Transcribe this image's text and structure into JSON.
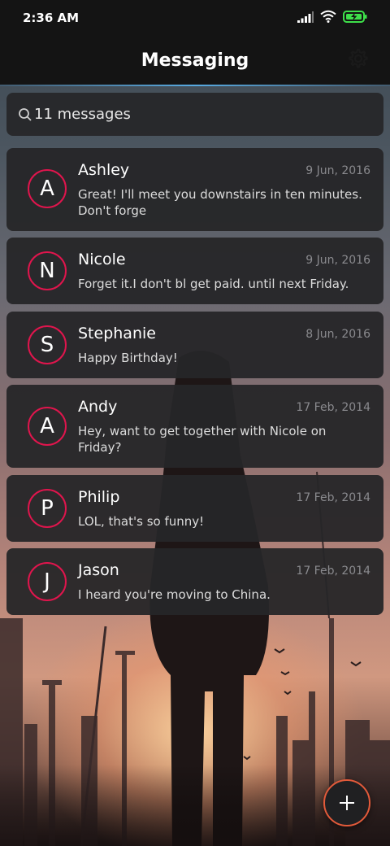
{
  "status_bar": {
    "time": "2:36 AM",
    "icons": [
      "signal-icon",
      "wifi-icon",
      "battery-charging-icon"
    ],
    "battery_color": "#3ee04a"
  },
  "app_bar": {
    "title": "Messaging",
    "settings_icon": "gear-icon"
  },
  "search": {
    "placeholder": "11 messages",
    "icon": "search-icon"
  },
  "accent_color": "#e0154d",
  "conversations": [
    {
      "initial": "A",
      "name": "Ashley",
      "date": "9 Jun, 2016",
      "snippet": "Great! I'll meet you downstairs in ten minutes. Don't forge"
    },
    {
      "initial": "N",
      "name": "Nicole",
      "date": "9 Jun, 2016",
      "snippet": "Forget it.I don't bl get paid. until next Friday."
    },
    {
      "initial": "S",
      "name": "Stephanie",
      "date": "8 Jun, 2016",
      "snippet": "Happy Birthday!"
    },
    {
      "initial": "A",
      "name": "Andy",
      "date": "17 Feb, 2014",
      "snippet": "Hey, want to get together with Nicole on Friday?"
    },
    {
      "initial": "P",
      "name": "Philip",
      "date": "17 Feb, 2014",
      "snippet": "LOL, that's so funny!"
    },
    {
      "initial": "J",
      "name": "Jason",
      "date": "17 Feb, 2014",
      "snippet": "I heard you're moving to China."
    }
  ],
  "fab": {
    "icon": "plus-icon"
  }
}
